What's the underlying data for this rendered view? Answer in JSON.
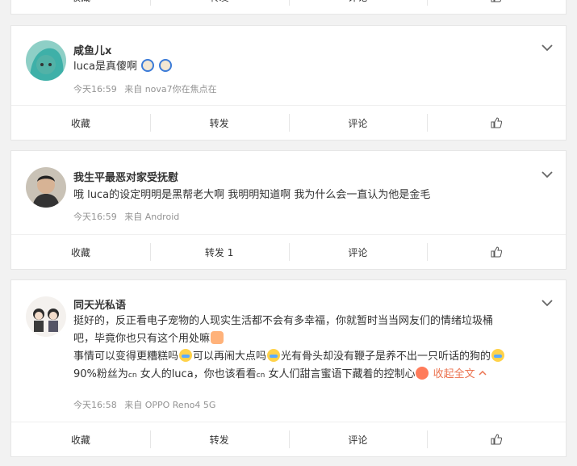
{
  "action_labels": {
    "collect": "收藏",
    "like_icon": "thumbs-up-icon"
  },
  "top_card": {
    "repost": "转发",
    "comment": "评论"
  },
  "posts": [
    {
      "name": "咸鱼儿x",
      "text": "luca是真傻啊",
      "time": "今天16:59",
      "source": "来自 nova7你在焦点在",
      "repost": "转发",
      "comment": "评论"
    },
    {
      "name": "我生平最恶对家受抚慰",
      "text": "哦 luca的设定明明是黑帮老大啊 我明明知道啊 我为什么会一直认为他是金毛",
      "time": "今天16:59",
      "source": "来自 Android",
      "repost": "转发 1",
      "comment": "评论"
    },
    {
      "name": "同天光私语",
      "line1": "挺好的，反正看电子宠物的人现实生活都不会有多幸福，你就暂时当当网友们的情绪垃圾桶",
      "line2": "吧，毕竟你也只有这个用处嘛",
      "line3a": "事情可以变得更糟糕吗",
      "line3b": "可以再闹大点吗",
      "line3c": "光有骨头却没有鞭子是养不出一只听话的狗的",
      "line4a": "90%粉丝为",
      "line4b": "cn",
      "line4c": " 女人的luca，你也该看看",
      "line4d": "cn",
      "line4e": " 女人们甜言蜜语下藏着的控制心",
      "collapse": "收起全文",
      "time": "今天16:58",
      "source": "来自 OPPO Reno4 5G",
      "repost": "转发",
      "comment": "评论"
    }
  ]
}
